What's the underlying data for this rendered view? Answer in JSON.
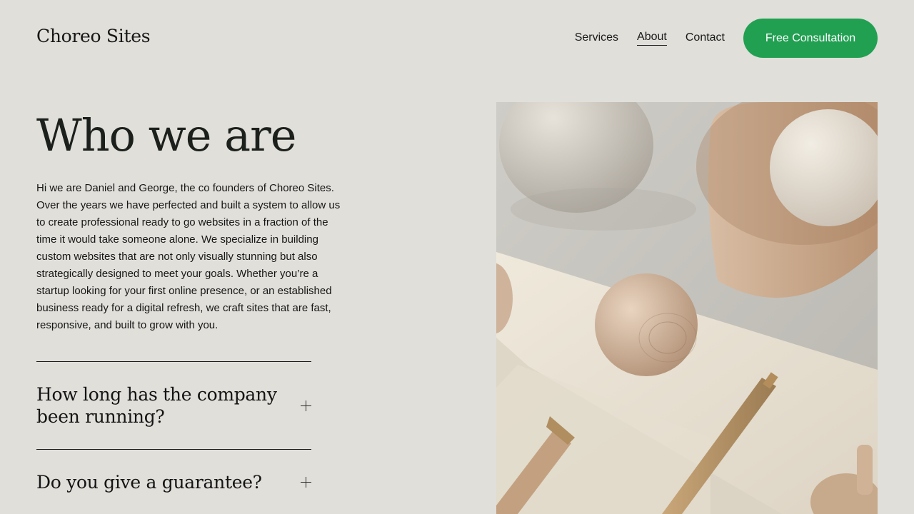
{
  "header": {
    "logo": "Choreo Sites",
    "nav": [
      {
        "label": "Services",
        "active": false
      },
      {
        "label": "About",
        "active": true
      },
      {
        "label": "Contact",
        "active": false
      }
    ],
    "cta_label": "Free Consultation"
  },
  "hero": {
    "title": "Who we are",
    "intro": "Hi we are Daniel and George, the co founders of Choreo Sites. Over the years we have perfected and built a system to allow us to create professional ready to go websites in a fraction of the time it would take someone alone. We specialize in building custom websites that are not only visually stunning but also strategically designed to meet your goals. Whether you’re a startup looking for your first online presence, or an established business ready for a digital refresh, we craft sites that are fast, responsive, and built to grow with you.",
    "image_icon": "still-life-photo"
  },
  "faq": [
    {
      "question": "How long has the company been running?",
      "icon": "plus-icon"
    },
    {
      "question": "Do you give a guarantee?",
      "icon": "plus-icon"
    }
  ],
  "colors": {
    "background": "#e0dfda",
    "accent": "#21a052",
    "text": "#1a1a1a"
  }
}
